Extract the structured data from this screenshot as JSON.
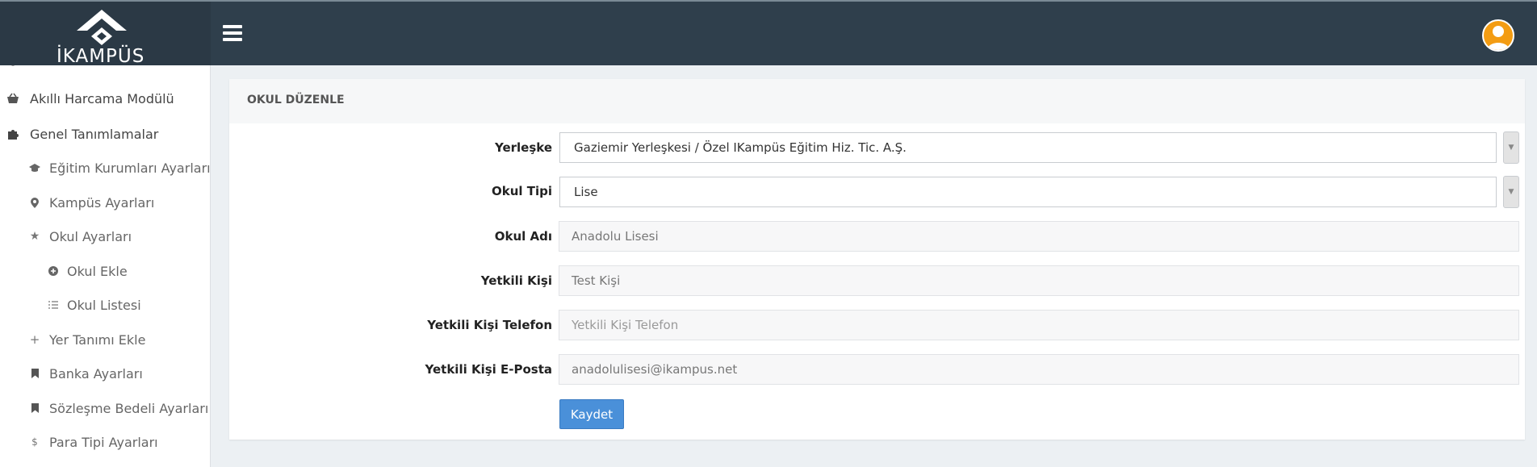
{
  "header": {
    "logo_text": "İKAMPÜS"
  },
  "sidebar": {
    "items": [
      {
        "label": "Akıllı Harcama Modülü",
        "icon": "basket-icon",
        "level": 0
      },
      {
        "label": "Genel Tanımlamalar",
        "icon": "puzzle-icon",
        "level": 0
      },
      {
        "label": "Eğitim Kurumları Ayarları",
        "icon": "graduation-cap-icon",
        "level": 1
      },
      {
        "label": "Kampüs Ayarları",
        "icon": "map-pin-icon",
        "level": 1
      },
      {
        "label": "Okul Ayarları",
        "icon": "star-icon",
        "level": 1
      },
      {
        "label": "Okul Ekle",
        "icon": "plus-circle-icon",
        "level": 2
      },
      {
        "label": "Okul Listesi",
        "icon": "list-icon",
        "level": 2
      },
      {
        "label": "Yer Tanımı Ekle",
        "icon": "plus-icon",
        "level": 1
      },
      {
        "label": "Banka Ayarları",
        "icon": "bookmark-icon",
        "level": 1
      },
      {
        "label": "Sözleşme Bedeli Ayarları",
        "icon": "bookmark-icon",
        "level": 1
      },
      {
        "label": "Para Tipi Ayarları",
        "icon": "dollar-icon",
        "level": 1
      }
    ]
  },
  "panel": {
    "title": "OKUL DÜZENLE",
    "fields": {
      "campus": {
        "label": "Yerleşke",
        "value": "Gaziemir Yerleşkesi / Özel IKampüs Eğitim Hiz. Tic. A.Ş."
      },
      "school_type": {
        "label": "Okul Tipi",
        "value": "Lise"
      },
      "school_name": {
        "label": "Okul Adı",
        "value": "Anadolu Lisesi"
      },
      "contact_person": {
        "label": "Yetkili Kişi",
        "value": "Test Kişi"
      },
      "contact_phone": {
        "label": "Yetkili Kişi Telefon",
        "placeholder": "Yetkili Kişi Telefon",
        "value": ""
      },
      "contact_email": {
        "label": "Yetkili Kişi E-Posta",
        "value": "anadolulisesi@ikampus.net"
      }
    },
    "save_label": "Kaydet"
  },
  "colors": {
    "header_bg": "#2f3f4c",
    "accent": "#4a90d9",
    "avatar": "#f39c12"
  }
}
